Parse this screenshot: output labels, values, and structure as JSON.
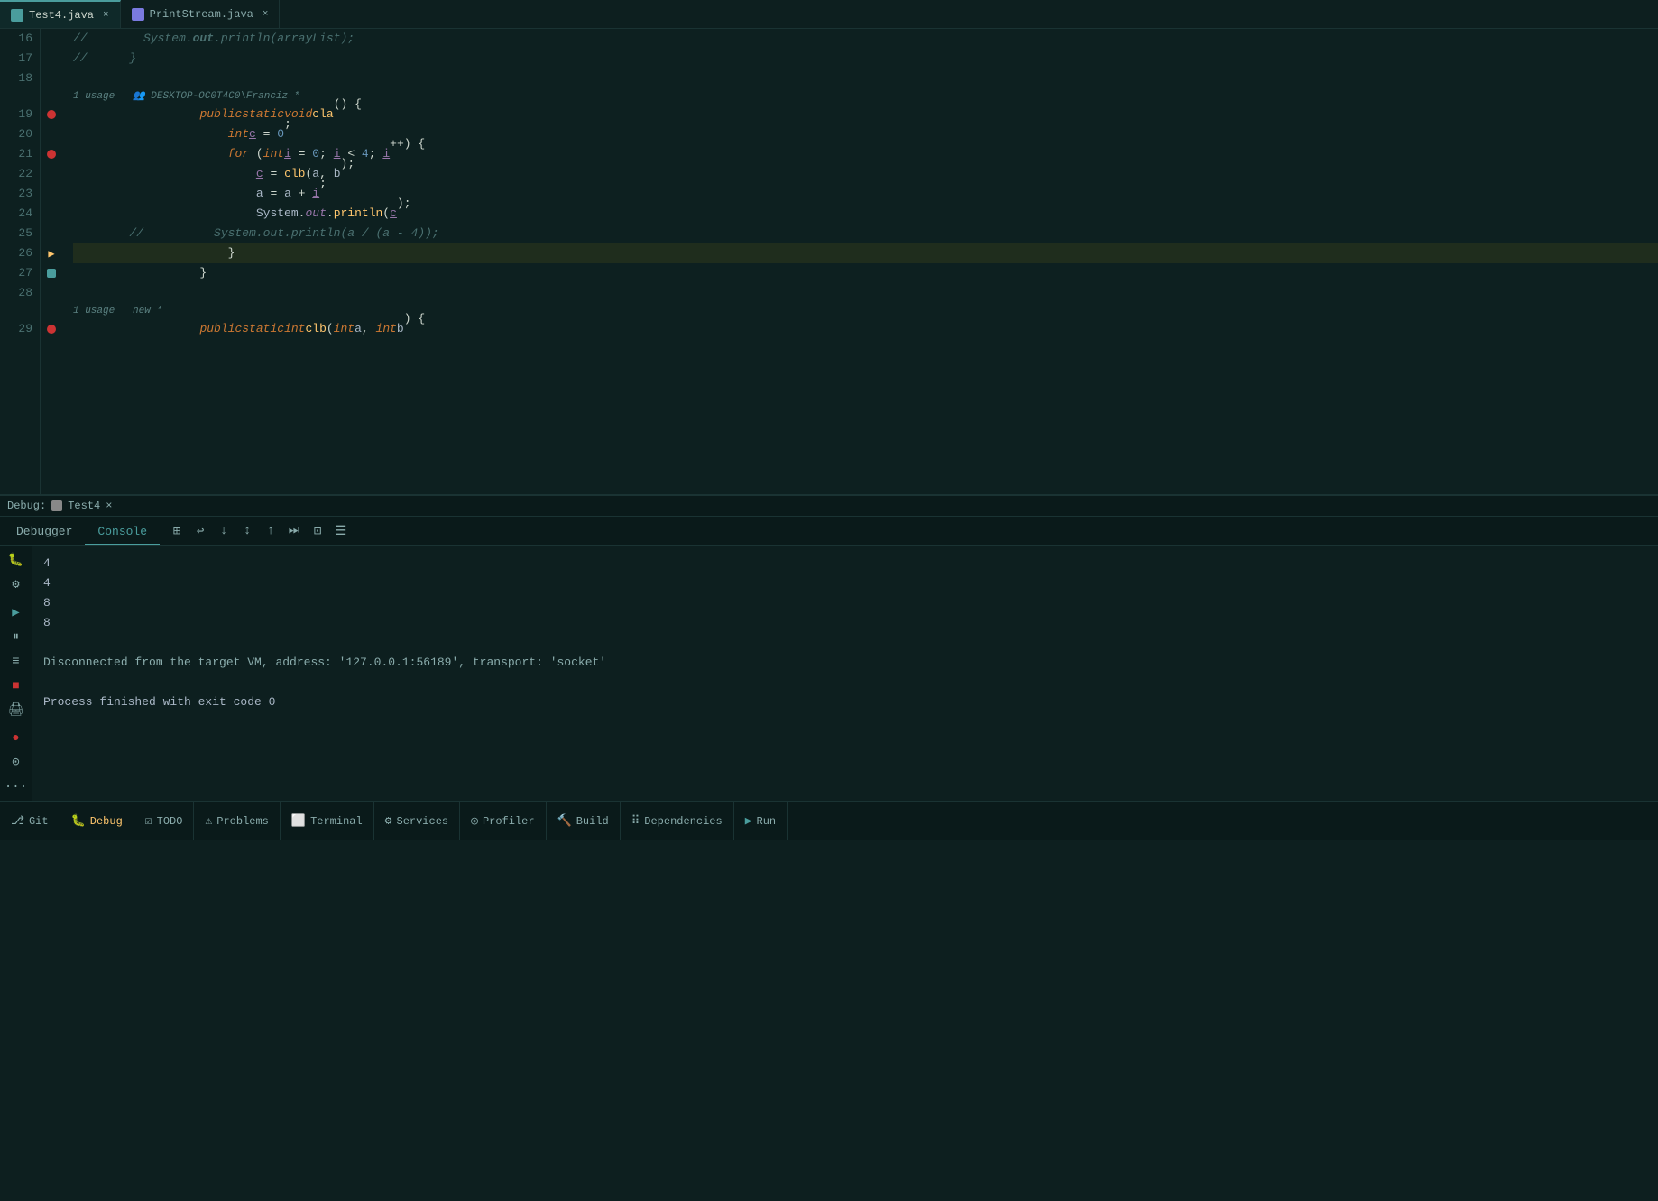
{
  "tabs": [
    {
      "id": "test4",
      "label": "Test4.java",
      "active": true,
      "iconColor": "#4a9d9d"
    },
    {
      "id": "printstream",
      "label": "PrintStream.java",
      "active": false,
      "iconColor": "#7a7adf"
    }
  ],
  "code": {
    "lines": [
      {
        "num": 16,
        "content": "        //        System.out.println(arrayList);",
        "type": "comment"
      },
      {
        "num": 17,
        "content": "//      }",
        "type": "comment"
      },
      {
        "num": 18,
        "content": ""
      },
      {
        "num": 19,
        "content": "        public static void cla() {",
        "type": "method",
        "hasBreakpoint": true
      },
      {
        "num": 20,
        "content": "            int c = 0;"
      },
      {
        "num": 21,
        "content": "            for (int i = 0; i < 4; i++) {",
        "hasBreakpoint": true
      },
      {
        "num": 22,
        "content": "                c = clb(a, b);"
      },
      {
        "num": 23,
        "content": "                a = a + i;"
      },
      {
        "num": 24,
        "content": "                System.out.println(c);"
      },
      {
        "num": 25,
        "content": "        //          System.out.println(a / (a - 4));",
        "type": "comment"
      },
      {
        "num": 26,
        "content": "            }",
        "hasArrow": true
      },
      {
        "num": 27,
        "content": "        }",
        "hasBookmark": true
      },
      {
        "num": 28,
        "content": ""
      },
      {
        "num": 29,
        "content": "        public static int clb(int a, int b) {",
        "hasBreakpoint": true
      }
    ],
    "usages": [
      {
        "afterLine": 18,
        "text": "1 usage   DESKTOP-OC0T4C0\\Franciz *"
      },
      {
        "afterLine": 28,
        "text": "1 usage   new *"
      }
    ]
  },
  "debug": {
    "session_label": "Debug:",
    "session_name": "Test4",
    "tabs": [
      {
        "id": "debugger",
        "label": "Debugger"
      },
      {
        "id": "console",
        "label": "Console",
        "active": true
      }
    ],
    "console_output": [
      "4",
      "4",
      "8",
      "8",
      "",
      "Disconnected from the target VM, address: '127.0.0.1:56189', transport: 'socket'",
      "",
      "Process finished with exit code 0"
    ]
  },
  "bottom_bar": [
    {
      "id": "git",
      "icon": "⎇",
      "label": "Git"
    },
    {
      "id": "debug",
      "icon": "🐛",
      "label": "Debug",
      "active": true
    },
    {
      "id": "todo",
      "icon": "☑",
      "label": "TODO"
    },
    {
      "id": "problems",
      "icon": "⚠",
      "label": "Problems"
    },
    {
      "id": "terminal",
      "icon": "⬜",
      "label": "Terminal"
    },
    {
      "id": "services",
      "icon": "⚙",
      "label": "Services"
    },
    {
      "id": "profiler",
      "icon": "◎",
      "label": "Profiler"
    },
    {
      "id": "build",
      "icon": "🔨",
      "label": "Build"
    },
    {
      "id": "dependencies",
      "icon": "⠿",
      "label": "Dependencies"
    },
    {
      "id": "run",
      "icon": "▶",
      "label": "Run"
    }
  ]
}
